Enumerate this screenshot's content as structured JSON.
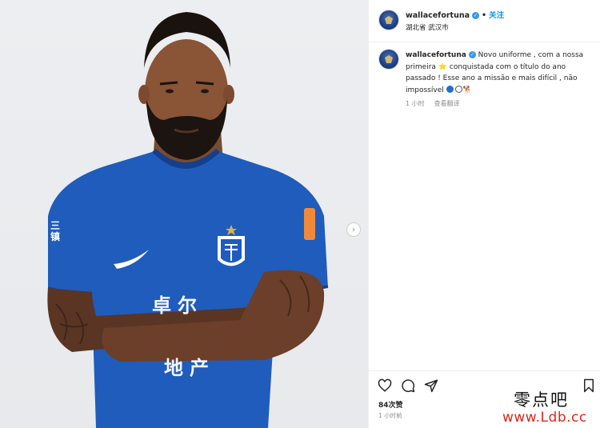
{
  "post": {
    "username": "wallacefortuna",
    "follow_label": "关注",
    "separator": "•",
    "location": "湖北省 武汉市",
    "caption": {
      "text_part1": "Novo uniforme , com a nossa primeira ",
      "text_part2": " conquistada com o título do ano passado ! Esse ano a missão e mais difícil , não impossível ",
      "star_emoji": "⭐",
      "dog_emoji": "🐕"
    },
    "caption_age": "1 小时",
    "translate_label": "查看翻译",
    "likes": "84次赞",
    "posted_ago": "1 小时前"
  },
  "photo": {
    "jersey_text_1": "卓尔",
    "jersey_text_2": "地产",
    "side_text": "三镇"
  },
  "icons": {
    "heart": "heart-icon",
    "comment": "comment-icon",
    "share": "share-icon",
    "bookmark": "bookmark-icon",
    "next": "chevron-right-icon",
    "verified": "verified-badge-icon"
  },
  "colors": {
    "jersey_blue": "#1f5cbc",
    "link_blue": "#0095f6",
    "verified_blue": "#3897f0",
    "muted_text": "#8e8e8e"
  },
  "watermark": {
    "line1": "零点吧",
    "line2": "www.Ldb.cc"
  }
}
